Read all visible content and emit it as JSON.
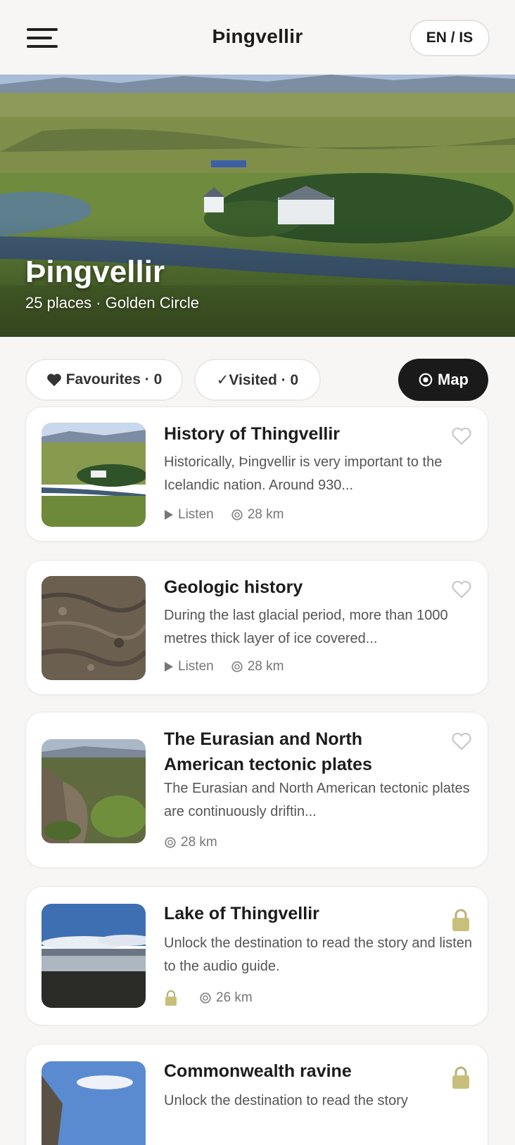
{
  "header": {
    "title": "Þingvellir",
    "language_toggle": "EN / IS"
  },
  "hero": {
    "title": "Þingvellir",
    "subtitle": "25 places · Golden Circle"
  },
  "filters": {
    "favourites": {
      "icon": "heart-icon",
      "label": "Favourites · 0"
    },
    "visited": {
      "icon": "check-icon",
      "label": "✓Visited · 0"
    },
    "map": {
      "icon": "map-pin-icon",
      "label": "Map"
    }
  },
  "places": [
    {
      "title": "History of Thingvellir",
      "description": "Historically, Þingvellir is very important to the Icelandic nation. Around 930...",
      "listen_label": "Listen",
      "distance": "28 km",
      "locked": false
    },
    {
      "title": "Geologic history",
      "description": "During the last glacial period, more than 1000 metres thick layer of ice covered...",
      "listen_label": "Listen",
      "distance": "28 km",
      "locked": false
    },
    {
      "title": "The Eurasian and North American tectonic plates",
      "description": "The Eurasian and North American tectonic plates are continuously driftin...",
      "distance": "28 km",
      "locked": false
    },
    {
      "title": "Lake of Thingvellir",
      "description": "Unlock the destination to read the story and listen to the audio guide.",
      "distance": "26 km",
      "locked": true
    },
    {
      "title": "Commonwealth ravine",
      "description": "Unlock the destination to read the story",
      "locked": true
    }
  ],
  "colors": {
    "background": "#f7f6f4",
    "card": "#ffffff",
    "map_button": "#1a1a1a",
    "lock_accent": "#c8c07a"
  }
}
